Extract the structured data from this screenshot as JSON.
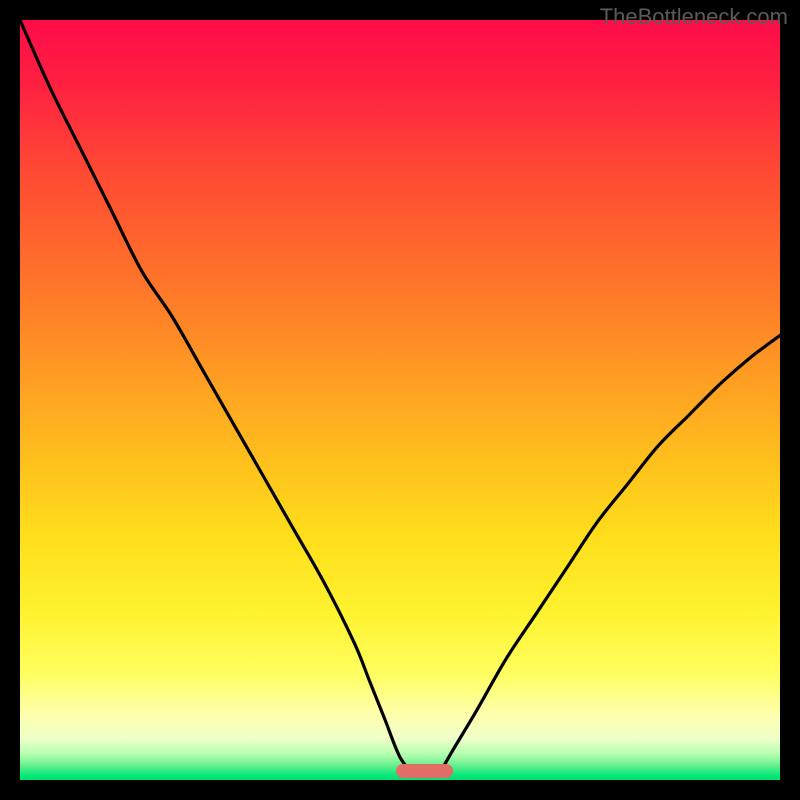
{
  "watermark": "TheBottleneck.com",
  "chart_data": {
    "type": "line",
    "title": "",
    "xlabel": "",
    "ylabel": "",
    "xlim": [
      0,
      100
    ],
    "ylim": [
      0,
      100
    ],
    "gradient_stops": [
      {
        "offset": 0.0,
        "color": "#ff0c49"
      },
      {
        "offset": 0.08,
        "color": "#ff1f41"
      },
      {
        "offset": 0.18,
        "color": "#ff4336"
      },
      {
        "offset": 0.28,
        "color": "#ff612e"
      },
      {
        "offset": 0.38,
        "color": "#ff7f28"
      },
      {
        "offset": 0.48,
        "color": "#ffa022"
      },
      {
        "offset": 0.58,
        "color": "#ffc01c"
      },
      {
        "offset": 0.68,
        "color": "#ffde1c"
      },
      {
        "offset": 0.78,
        "color": "#fff22e"
      },
      {
        "offset": 0.86,
        "color": "#ffff60"
      },
      {
        "offset": 0.91,
        "color": "#ffffa8"
      },
      {
        "offset": 0.945,
        "color": "#f0ffc8"
      },
      {
        "offset": 0.965,
        "color": "#b8ffb0"
      },
      {
        "offset": 0.98,
        "color": "#6cf090"
      },
      {
        "offset": 0.995,
        "color": "#00e878"
      },
      {
        "offset": 1.0,
        "color": "#00e070"
      }
    ],
    "series": [
      {
        "name": "left_curve",
        "x": [
          0.0,
          4.0,
          8.0,
          12.0,
          16.0,
          20.0,
          24.0,
          28.0,
          32.0,
          36.0,
          40.0,
          44.0,
          46.0,
          48.0,
          50.0,
          52.0
        ],
        "values": [
          100,
          91,
          83,
          75,
          67,
          61,
          54,
          47,
          40,
          33,
          26,
          18,
          13,
          8,
          3,
          0.5
        ]
      },
      {
        "name": "right_curve",
        "x": [
          55.0,
          57.0,
          60.0,
          64.0,
          68.0,
          72.0,
          76.0,
          80.0,
          84.0,
          88.0,
          92.0,
          96.0,
          100.0
        ],
        "values": [
          0.5,
          4.0,
          9.0,
          16.0,
          22.0,
          28.0,
          34.0,
          39.0,
          44.0,
          48.0,
          52.0,
          55.5,
          58.5
        ]
      }
    ],
    "marker": {
      "x_start": 49.5,
      "x_end": 57.0,
      "y": 0.0,
      "color": "#e16e64"
    }
  }
}
